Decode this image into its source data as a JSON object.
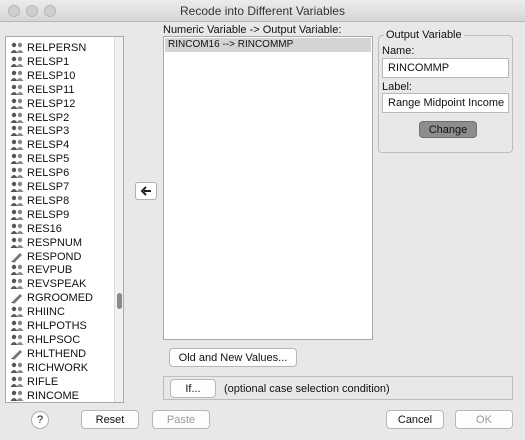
{
  "window": {
    "title": "Recode into Different Variables"
  },
  "variable_list": {
    "items": [
      {
        "label": "RELPERSN",
        "icon": "scale-icon"
      },
      {
        "label": "RELSP1",
        "icon": "scale-icon"
      },
      {
        "label": "RELSP10",
        "icon": "scale-icon"
      },
      {
        "label": "RELSP11",
        "icon": "scale-icon"
      },
      {
        "label": "RELSP12",
        "icon": "scale-icon"
      },
      {
        "label": "RELSP2",
        "icon": "scale-icon"
      },
      {
        "label": "RELSP3",
        "icon": "scale-icon"
      },
      {
        "label": "RELSP4",
        "icon": "scale-icon"
      },
      {
        "label": "RELSP5",
        "icon": "scale-icon"
      },
      {
        "label": "RELSP6",
        "icon": "scale-icon"
      },
      {
        "label": "RELSP7",
        "icon": "scale-icon"
      },
      {
        "label": "RELSP8",
        "icon": "scale-icon"
      },
      {
        "label": "RELSP9",
        "icon": "scale-icon"
      },
      {
        "label": "RES16",
        "icon": "scale-icon"
      },
      {
        "label": "RESPNUM",
        "icon": "scale-icon"
      },
      {
        "label": "RESPOND",
        "icon": "pencil-icon"
      },
      {
        "label": "REVPUB",
        "icon": "scale-icon"
      },
      {
        "label": "REVSPEAK",
        "icon": "scale-icon"
      },
      {
        "label": "RGROOMED",
        "icon": "pencil-icon"
      },
      {
        "label": "RHIINC",
        "icon": "scale-icon"
      },
      {
        "label": "RHLPOTHS",
        "icon": "scale-icon"
      },
      {
        "label": "RHLPSOC",
        "icon": "scale-icon"
      },
      {
        "label": "RHLTHEND",
        "icon": "pencil-icon"
      },
      {
        "label": "RICHWORK",
        "icon": "scale-icon"
      },
      {
        "label": "RIFLE",
        "icon": "scale-icon"
      },
      {
        "label": "RINCOME",
        "icon": "scale-icon"
      }
    ]
  },
  "mapping": {
    "header": "Numeric Variable -> Output Variable:",
    "rows": [
      "RINCOM16 --> RINCOMMP"
    ]
  },
  "output_variable": {
    "legend": "Output Variable",
    "name_label": "Name:",
    "name_value": "RINCOMMP",
    "label_label": "Label:",
    "label_value": "Range Midpoint Income",
    "change_button": "Change"
  },
  "buttons": {
    "old_new": "Old and New Values...",
    "if": "If...",
    "if_hint": "(optional case selection condition)",
    "help": "?",
    "reset": "Reset",
    "paste": "Paste",
    "cancel": "Cancel",
    "ok": "OK"
  }
}
